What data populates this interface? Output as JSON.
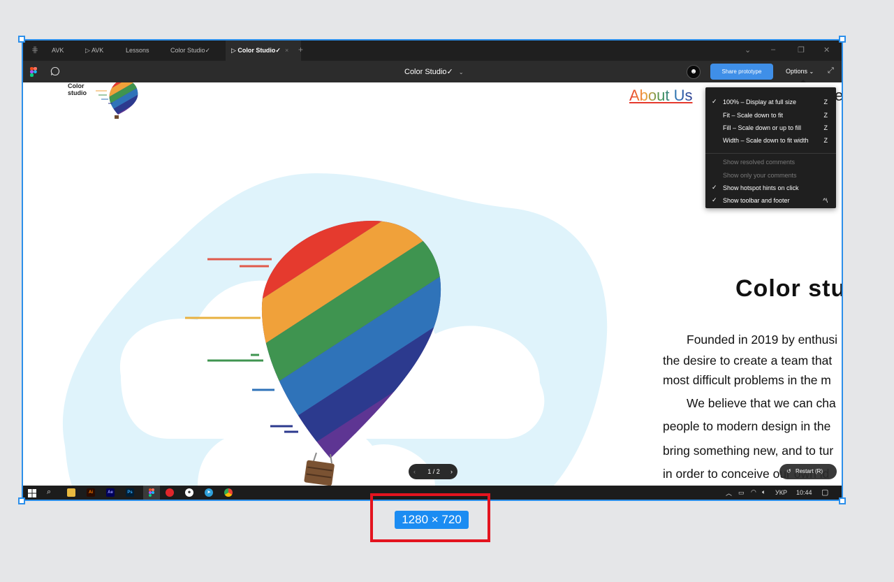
{
  "browser_tabs": [
    {
      "label": "AVK",
      "icon": "",
      "active": false
    },
    {
      "label": "AVK",
      "icon": "play-icon",
      "active": false
    },
    {
      "label": "Lessons",
      "icon": "",
      "active": false
    },
    {
      "label": "Color Studio✓",
      "icon": "",
      "active": false
    },
    {
      "label": "Color Studio✓",
      "icon": "play-icon",
      "active": true
    }
  ],
  "toolbar": {
    "file_title": "Color Studio✓",
    "share_label": "Share prototype",
    "options_label": "Options"
  },
  "page": {
    "logo_line1": "Color",
    "logo_line2": "studio",
    "nav_about": "About Us",
    "nav_next": "es",
    "heading": "Color stu",
    "paragraph_lines": [
      "Founded in 2019 by enthusi",
      "the desire to create a team that",
      "most difficult problems in the m",
      "We believe that we can cha",
      "people to modern design in the",
      "bring something new, and to tur",
      "in order to conceive our own id"
    ]
  },
  "options_menu": {
    "items": [
      {
        "label": "100% – Display at full size",
        "key": "Z",
        "checked": true,
        "disabled": false
      },
      {
        "label": "Fit – Scale down to fit",
        "key": "Z",
        "checked": false,
        "disabled": false
      },
      {
        "label": "Fill – Scale down or up to fill",
        "key": "Z",
        "checked": false,
        "disabled": false
      },
      {
        "label": "Width – Scale down to fit width",
        "key": "Z",
        "checked": false,
        "disabled": false
      },
      {
        "label": "Show resolved comments",
        "key": "",
        "checked": false,
        "disabled": true
      },
      {
        "label": "Show only your comments",
        "key": "",
        "checked": false,
        "disabled": true
      },
      {
        "label": "Show hotspot hints on click",
        "key": "",
        "checked": true,
        "disabled": false
      },
      {
        "label": "Show toolbar and footer",
        "key": "^\\",
        "checked": true,
        "disabled": false
      }
    ]
  },
  "pager": {
    "page": "1 / 2"
  },
  "restart_label": "Restart (R)",
  "taskbar": {
    "apps": [
      "Ai",
      "Ae",
      "Ps"
    ],
    "language": "УКР",
    "time": "10:44"
  },
  "canvas_size_label": "1280 × 720",
  "colors": {
    "accent": "#2c8fea",
    "share_button": "#3f8fe8",
    "rainbow": [
      "#e53a2e",
      "#f0a13a",
      "#3f9450",
      "#2f73b9",
      "#2c3a8e",
      "#5e3593"
    ],
    "highlight": "#e3141f"
  }
}
